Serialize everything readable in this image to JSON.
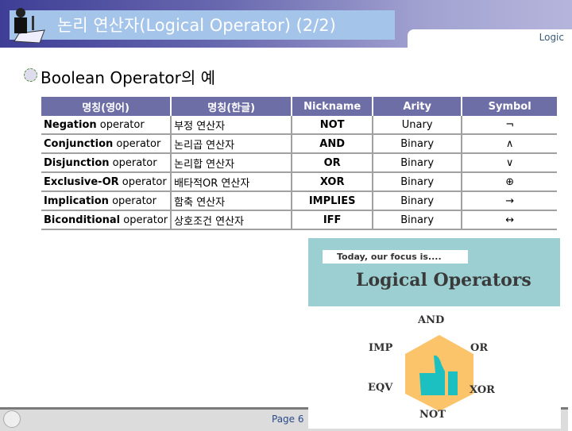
{
  "header": {
    "title": "논리 연산자(Logical Operator) (2/2)",
    "tag": "Logic"
  },
  "subheading": "Boolean Operator의 예",
  "table": {
    "columns": [
      "명칭(영어)",
      "명칭(한글)",
      "Nickname",
      "Arity",
      "Symbol"
    ],
    "rows": [
      {
        "en_bold": "Negation",
        "en": " operator",
        "ko": "부정 연산자",
        "nick": "NOT",
        "arity": "Unary",
        "symbol": "¬"
      },
      {
        "en_bold": "Conjunction",
        "en": " operator",
        "ko": "논리곱 연산자",
        "nick": "AND",
        "arity": "Binary",
        "symbol": "∧"
      },
      {
        "en_bold": "Disjunction",
        "en": " operator",
        "ko": "논리합 연산자",
        "nick": "OR",
        "arity": "Binary",
        "symbol": "∨"
      },
      {
        "en_bold": "Exclusive-OR",
        "en": " operator",
        "ko": "배타적OR 연산자",
        "nick": "XOR",
        "arity": "Binary",
        "symbol": "⊕"
      },
      {
        "en_bold": "Implication",
        "en": " operator",
        "ko": "함축 연산자",
        "nick": "IMPLIES",
        "arity": "Binary",
        "symbol": "→"
      },
      {
        "en_bold": "Biconditional",
        "en": " operator",
        "ko": "상호조건 연산자",
        "nick": "IFF",
        "arity": "Binary",
        "symbol": "↔"
      }
    ]
  },
  "graphic": {
    "caption": "Today, our focus is....",
    "title": "Logical Operators",
    "ops": [
      "AND",
      "OR",
      "XOR",
      "NOT",
      "EQV",
      "IMP"
    ],
    "colors": {
      "teal": "#9ccfd1",
      "hexagon": "#fcc46a",
      "thumb": "#1cc0c0"
    }
  },
  "footer": {
    "page": "Page 6"
  }
}
